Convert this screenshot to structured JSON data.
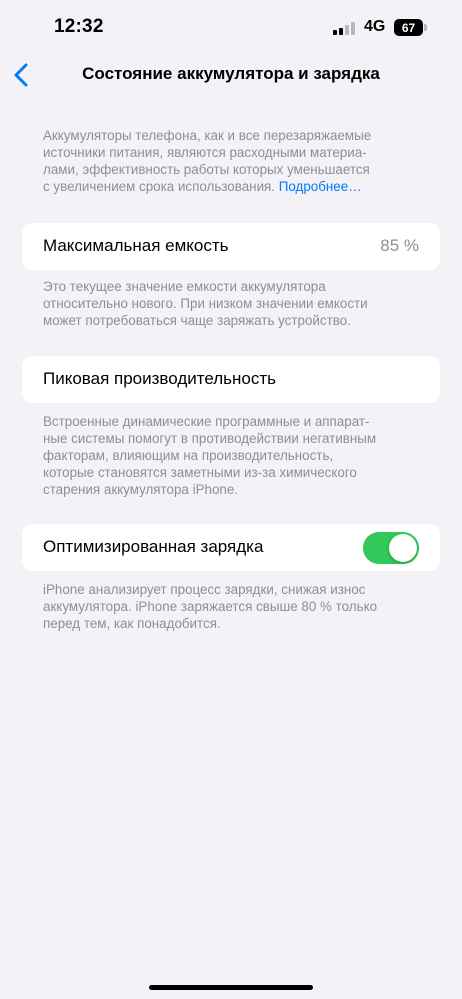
{
  "status_bar": {
    "time": "12:32",
    "network": "4G",
    "battery_level": "67"
  },
  "nav": {
    "title": "Состояние аккумулятора и зарядка"
  },
  "intro": {
    "line1": "Аккумуляторы телефона, как и все перезаряжаемые",
    "line2": "источники питания, являются расходными материа-",
    "line3": "лами, эффективность работы которых уменьшается",
    "line4": "с увеличением срока использования.",
    "link": "Подробнее…"
  },
  "max_capacity": {
    "label": "Максимальная емкость",
    "value": "85 %",
    "footnote": {
      "line1": "Это текущее значение емкости аккумулятора",
      "line2": "относительно нового. При низком значении емкости",
      "line3": "может потребоваться чаще заряжать устройство."
    }
  },
  "peak_performance": {
    "label": "Пиковая производительность",
    "footnote": {
      "line1": "Встроенные динамические программные и аппарат-",
      "line2": "ные системы помогут в противодействии негативным",
      "line3": "факторам, влияющим на производительность,",
      "line4": "которые становятся заметными из-за химического",
      "line5": "старения аккумулятора iPhone."
    }
  },
  "optimized_charging": {
    "label": "Оптимизированная зарядка",
    "enabled": true,
    "footnote": {
      "line1": "iPhone анализирует процесс зарядки, снижая износ",
      "line2": "аккумулятора. iPhone заряжается свыше 80 % только",
      "line3": "перед тем, как понадобится."
    }
  },
  "colors": {
    "background": "#f2f2f7",
    "accent": "#007aff",
    "toggle_on": "#34c759",
    "secondary_text": "#8e8e93"
  },
  "icons": {
    "back": "chevron-left-icon",
    "signal": "cellular-signal-icon",
    "battery": "battery-icon"
  }
}
